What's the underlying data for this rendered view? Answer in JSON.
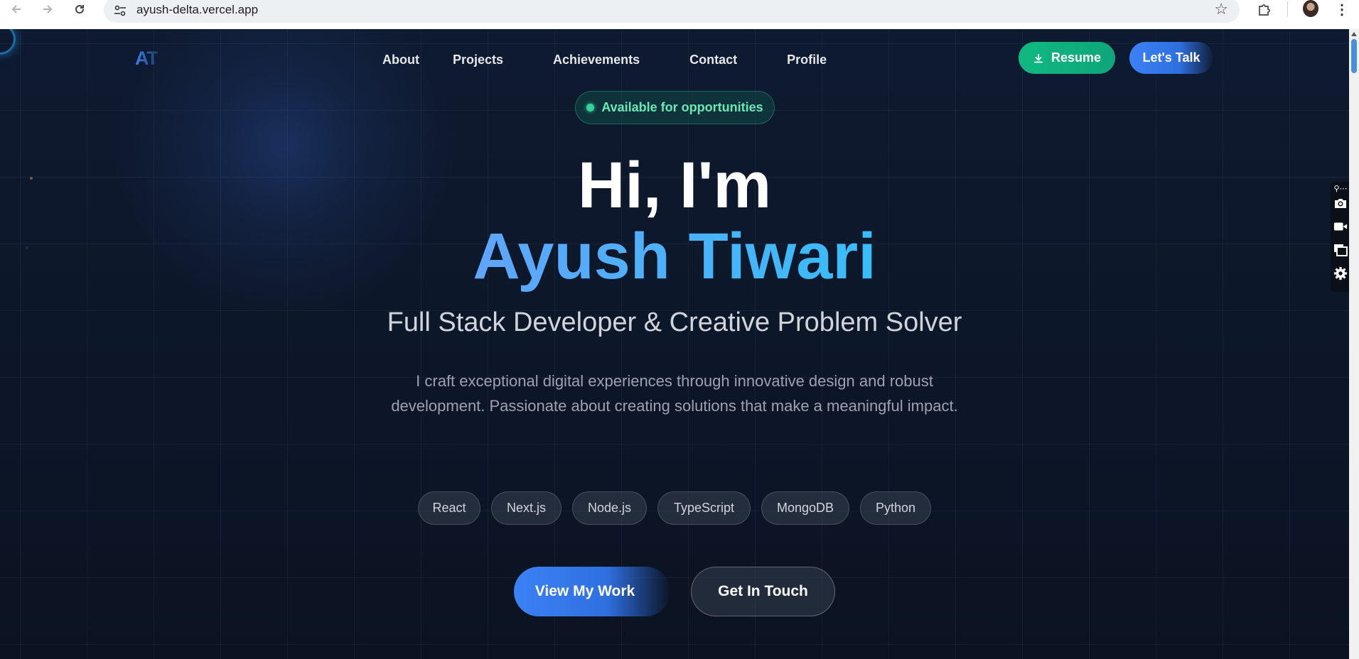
{
  "browser": {
    "url": "ayush-delta.vercel.app"
  },
  "site": {
    "logo": "AT",
    "nav": [
      "About",
      "Projects",
      "Achievements",
      "Contact",
      "Profile"
    ],
    "resume_label": "Resume",
    "talk_label": "Let's Talk"
  },
  "hero": {
    "badge": "Available for opportunities",
    "greeting": "Hi, I'm",
    "name": "Ayush Tiwari",
    "subtitle": "Full Stack Developer & Creative Problem Solver",
    "description_line1": "I craft exceptional digital experiences through innovative design and robust",
    "description_line2": "development. Passionate about creating solutions that make a meaningful impact.",
    "skills": [
      "React",
      "Next.js",
      "Node.js",
      "TypeScript",
      "MongoDB",
      "Python"
    ],
    "primary_cta": "View My Work",
    "secondary_cta": "Get In Touch"
  },
  "colors": {
    "background": "#0b1220",
    "accent_blue": "#3b82f6",
    "accent_green": "#10b981",
    "name_gradient": "#38bdf8"
  },
  "icons": {
    "back": "arrow-left-icon",
    "forward": "arrow-right-icon",
    "reload": "reload-icon",
    "site_info": "tune-icon",
    "bookmark": "star-icon",
    "extensions": "puzzle-icon",
    "menu": "more-vert-icon",
    "download": "download-icon",
    "tools": [
      "pin-icon",
      "camera-icon",
      "video-icon",
      "windows-icon",
      "gear-icon"
    ]
  }
}
